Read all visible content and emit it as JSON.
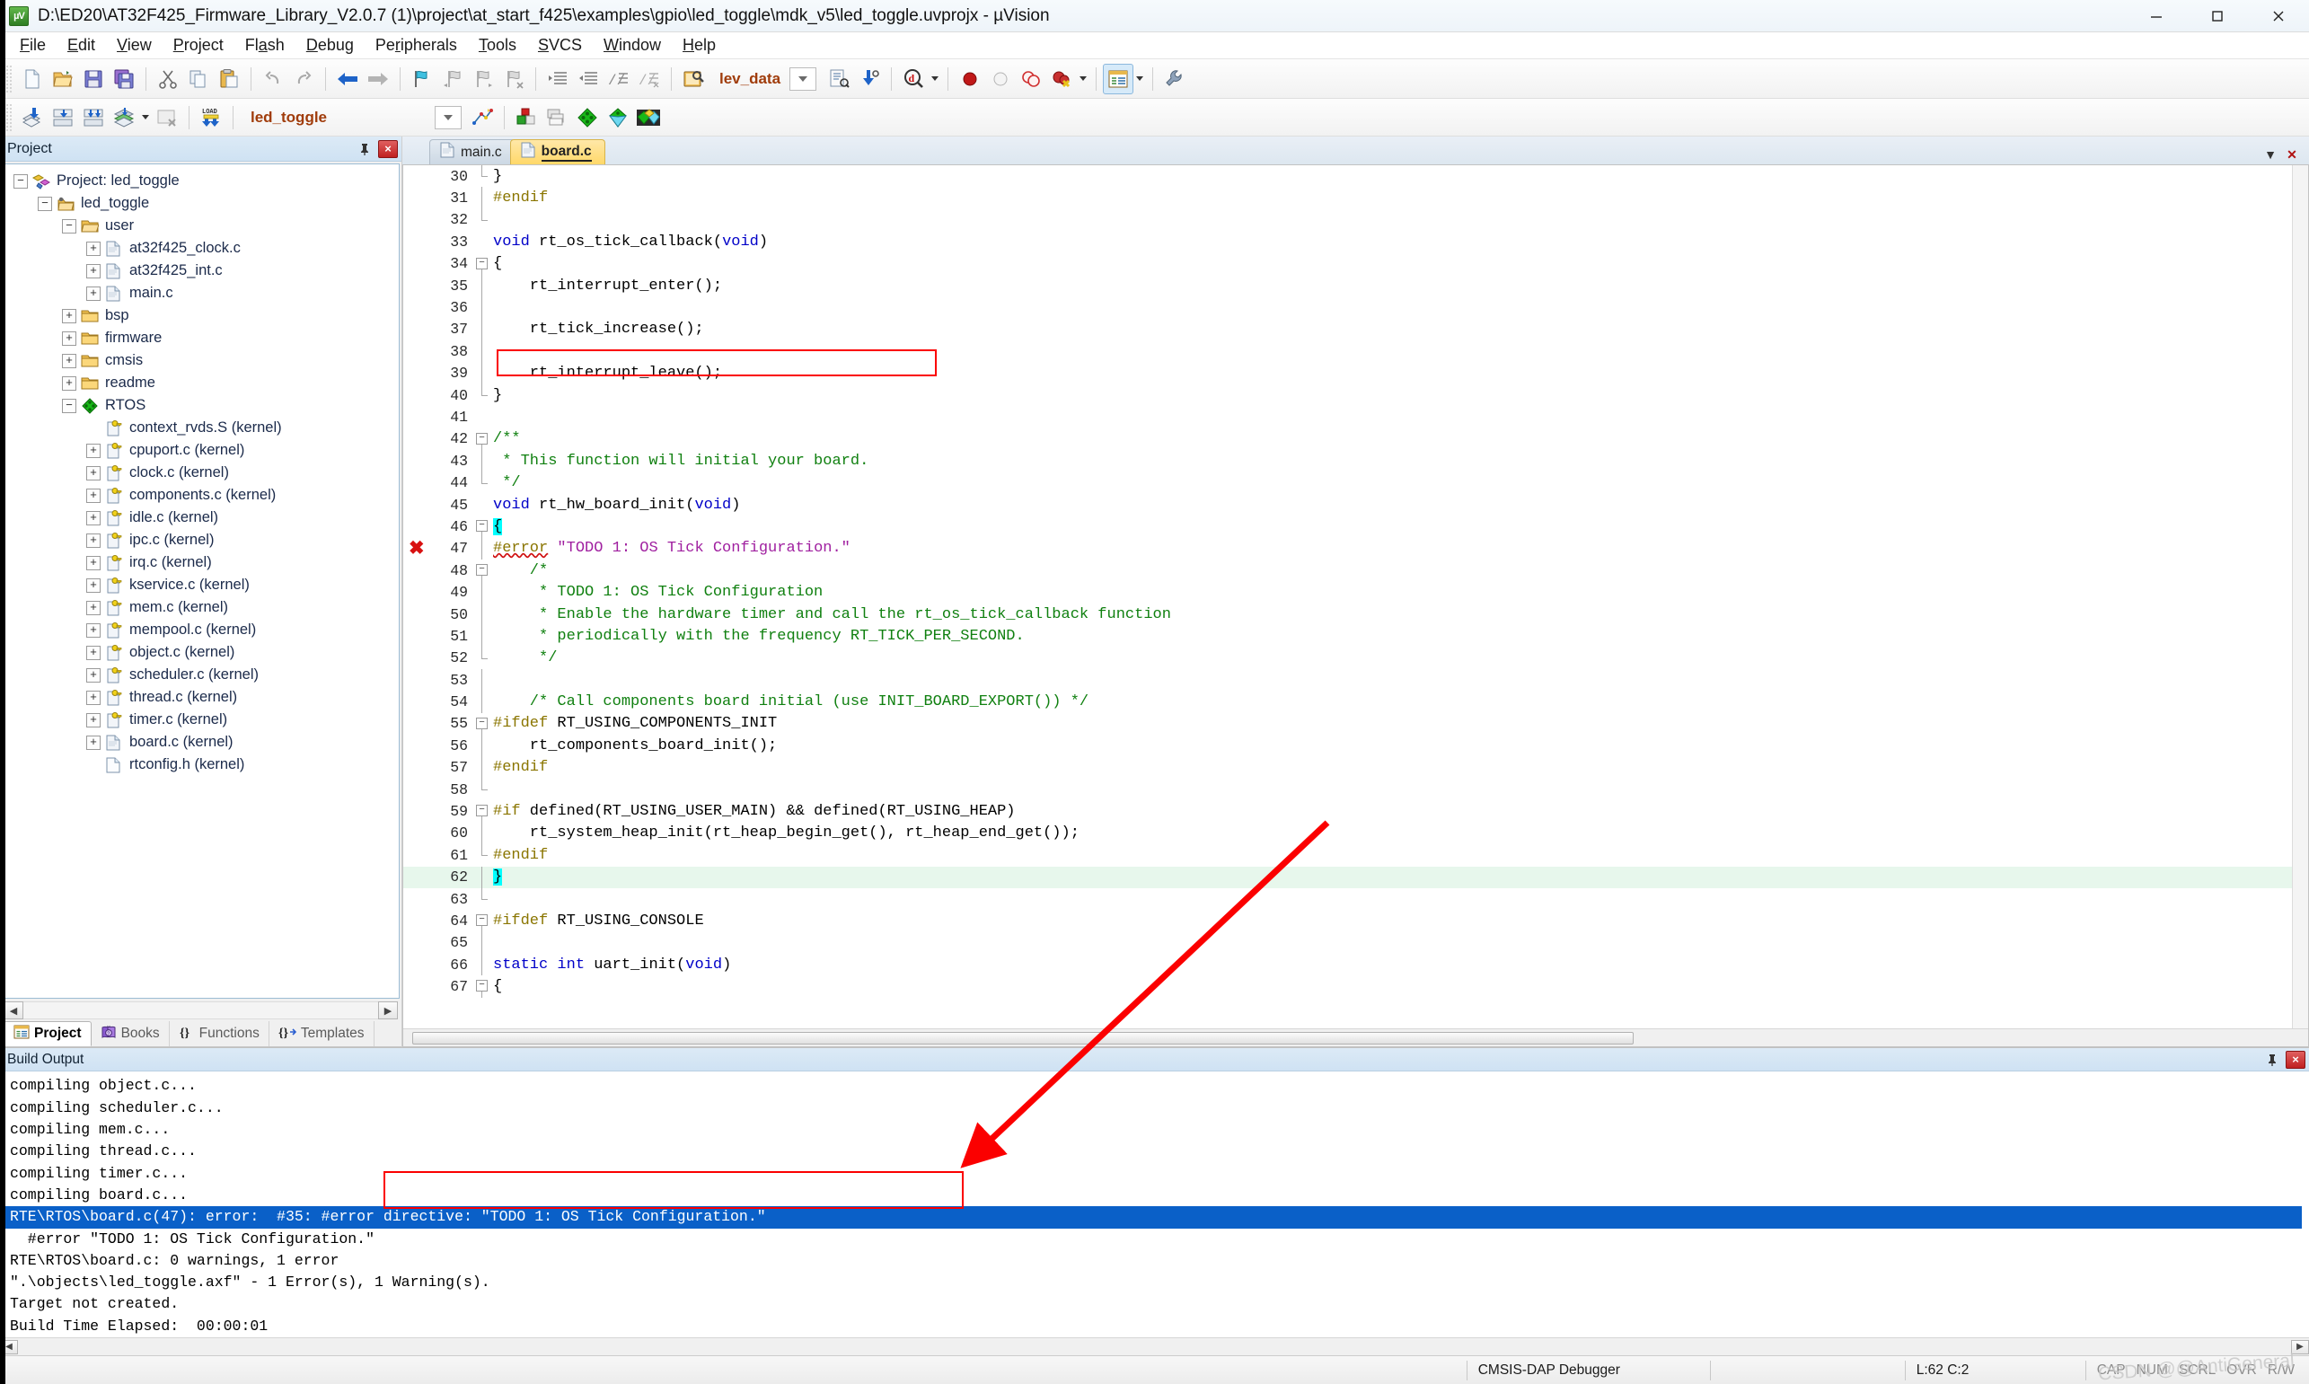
{
  "window": {
    "title": "D:\\ED20\\AT32F425_Firmware_Library_V2.0.7 (1)\\project\\at_start_f425\\examples\\gpio\\led_toggle\\mdk_v5\\led_toggle.uvprojx - µVision",
    "app_icon_text": "µV",
    "minimize": "─",
    "maximize": "❐",
    "close": "✕"
  },
  "menu": [
    {
      "label": "File",
      "accel": "F"
    },
    {
      "label": "Edit",
      "accel": "E"
    },
    {
      "label": "View",
      "accel": "V"
    },
    {
      "label": "Project",
      "accel": "P"
    },
    {
      "label": "Flash",
      "accel": "a"
    },
    {
      "label": "Debug",
      "accel": "D"
    },
    {
      "label": "Peripherals",
      "accel": "r"
    },
    {
      "label": "Tools",
      "accel": "T"
    },
    {
      "label": "SVCS",
      "accel": "S"
    },
    {
      "label": "Window",
      "accel": "W"
    },
    {
      "label": "Help",
      "accel": "H"
    }
  ],
  "toolbar_main": {
    "search_value": "lev_data",
    "icons": [
      "new-file-icon",
      "open-file-icon",
      "save-icon",
      "save-all-icon",
      "cut-icon",
      "copy-icon",
      "paste-icon",
      "undo-icon",
      "redo-icon",
      "navigate-back-icon",
      "navigate-forward-icon",
      "bookmark-toggle-icon",
      "bookmark-prev-icon",
      "bookmark-next-icon",
      "bookmark-clear-icon",
      "indent-icon",
      "outdent-icon",
      "comment-icon",
      "uncomment-icon",
      "find-in-files-icon"
    ],
    "right_icons": [
      "insert-template-icon",
      "configure-debug-icon",
      "find-icon",
      "insert-breakpoint-icon",
      "disable-breakpoint-icon",
      "disable-all-breakpoints-icon",
      "kill-all-breakpoints-icon",
      "project-window-icon",
      "configure-icon"
    ]
  },
  "toolbar_build": {
    "target_value": "led_toggle",
    "icons": [
      "translate-icon",
      "build-icon",
      "rebuild-icon",
      "batch-build-icon",
      "stop-build-icon",
      "download-icon",
      "target-options-icon",
      "manage-project-items-icon",
      "pack-installer-icon",
      "manage-rte-icon",
      "select-software-packs-icon"
    ]
  },
  "project_panel": {
    "title": "Project",
    "pin_icon": "pin-icon",
    "close_icon": "close-icon",
    "tree": [
      {
        "label": "Project: led_toggle",
        "depth": 0,
        "expander": "minus",
        "icon": "project-icon"
      },
      {
        "label": "led_toggle",
        "depth": 1,
        "expander": "minus",
        "icon": "target-icon"
      },
      {
        "label": "user",
        "depth": 2,
        "expander": "minus",
        "icon": "folder-open-icon"
      },
      {
        "label": "at32f425_clock.c",
        "depth": 3,
        "expander": "plus",
        "icon": "c-file-icon"
      },
      {
        "label": "at32f425_int.c",
        "depth": 3,
        "expander": "plus",
        "icon": "c-file-icon"
      },
      {
        "label": "main.c",
        "depth": 3,
        "expander": "plus",
        "icon": "c-file-icon"
      },
      {
        "label": "bsp",
        "depth": 2,
        "expander": "plus",
        "icon": "folder-icon"
      },
      {
        "label": "firmware",
        "depth": 2,
        "expander": "plus",
        "icon": "folder-icon"
      },
      {
        "label": "cmsis",
        "depth": 2,
        "expander": "plus",
        "icon": "folder-icon"
      },
      {
        "label": "readme",
        "depth": 2,
        "expander": "plus",
        "icon": "folder-icon"
      },
      {
        "label": "RTOS",
        "depth": 2,
        "expander": "minus",
        "icon": "rte-component-icon"
      },
      {
        "label": "context_rvds.S (kernel)",
        "depth": 3,
        "expander": "none",
        "icon": "rte-file-icon"
      },
      {
        "label": "cpuport.c (kernel)",
        "depth": 3,
        "expander": "plus",
        "icon": "rte-file-icon"
      },
      {
        "label": "clock.c (kernel)",
        "depth": 3,
        "expander": "plus",
        "icon": "rte-file-icon"
      },
      {
        "label": "components.c (kernel)",
        "depth": 3,
        "expander": "plus",
        "icon": "rte-file-icon"
      },
      {
        "label": "idle.c (kernel)",
        "depth": 3,
        "expander": "plus",
        "icon": "rte-file-icon"
      },
      {
        "label": "ipc.c (kernel)",
        "depth": 3,
        "expander": "plus",
        "icon": "rte-file-icon"
      },
      {
        "label": "irq.c (kernel)",
        "depth": 3,
        "expander": "plus",
        "icon": "rte-file-icon"
      },
      {
        "label": "kservice.c (kernel)",
        "depth": 3,
        "expander": "plus",
        "icon": "rte-file-icon"
      },
      {
        "label": "mem.c (kernel)",
        "depth": 3,
        "expander": "plus",
        "icon": "rte-file-icon"
      },
      {
        "label": "mempool.c (kernel)",
        "depth": 3,
        "expander": "plus",
        "icon": "rte-file-icon"
      },
      {
        "label": "object.c (kernel)",
        "depth": 3,
        "expander": "plus",
        "icon": "rte-file-icon"
      },
      {
        "label": "scheduler.c (kernel)",
        "depth": 3,
        "expander": "plus",
        "icon": "rte-file-icon"
      },
      {
        "label": "thread.c (kernel)",
        "depth": 3,
        "expander": "plus",
        "icon": "rte-file-icon"
      },
      {
        "label": "timer.c (kernel)",
        "depth": 3,
        "expander": "plus",
        "icon": "rte-file-icon"
      },
      {
        "label": "board.c (kernel)",
        "depth": 3,
        "expander": "plus",
        "icon": "c-file-icon"
      },
      {
        "label": "rtconfig.h (kernel)",
        "depth": 3,
        "expander": "none",
        "icon": "h-file-icon"
      }
    ],
    "bottom_tabs": [
      {
        "label": "Project",
        "icon": "project-window-icon",
        "selected": true
      },
      {
        "label": "Books",
        "icon": "books-icon",
        "selected": false
      },
      {
        "label": "Functions",
        "icon": "functions-icon",
        "selected": false
      },
      {
        "label": "Templates",
        "icon": "templates-icon",
        "selected": false
      }
    ]
  },
  "editor": {
    "tabs": [
      {
        "label": "main.c",
        "active": false,
        "icon": "c-file-icon"
      },
      {
        "label": "board.c",
        "active": true,
        "icon": "c-file-icon"
      }
    ],
    "lines": [
      {
        "n": "30",
        "fold": "end",
        "text": "}",
        "cls": "plain"
      },
      {
        "n": "31",
        "fold": "bar",
        "text": "#endif",
        "cls": "pp"
      },
      {
        "n": "32",
        "fold": "endbar",
        "text": "",
        "cls": "plain"
      },
      {
        "n": "33",
        "fold": "none",
        "text": "void rt_os_tick_callback(void)",
        "cls": "fn1"
      },
      {
        "n": "34",
        "fold": "start",
        "text": "{",
        "cls": "plain"
      },
      {
        "n": "35",
        "fold": "bar",
        "text": "    rt_interrupt_enter();",
        "cls": "plain"
      },
      {
        "n": "36",
        "fold": "bar",
        "text": "",
        "cls": "plain"
      },
      {
        "n": "37",
        "fold": "bar",
        "text": "    rt_tick_increase();",
        "cls": "plain"
      },
      {
        "n": "38",
        "fold": "bar",
        "text": "",
        "cls": "plain"
      },
      {
        "n": "39",
        "fold": "bar",
        "text": "    rt_interrupt_leave();",
        "cls": "plain"
      },
      {
        "n": "40",
        "fold": "end",
        "text": "}",
        "cls": "plain"
      },
      {
        "n": "41",
        "fold": "none",
        "text": "",
        "cls": "plain"
      },
      {
        "n": "42",
        "fold": "start",
        "text": "/**",
        "cls": "cmt"
      },
      {
        "n": "43",
        "fold": "bar",
        "text": " * This function will initial your board.",
        "cls": "cmt"
      },
      {
        "n": "44",
        "fold": "end",
        "text": " */",
        "cls": "cmt"
      },
      {
        "n": "45",
        "fold": "none",
        "text": "void rt_hw_board_init(void)",
        "cls": "fn2"
      },
      {
        "n": "46",
        "fold": "start",
        "text": "{",
        "cls": "cursor-brace"
      },
      {
        "n": "47",
        "fold": "bar",
        "text": "#error \"TODO 1: OS Tick Configuration.\"",
        "cls": "error-line"
      },
      {
        "n": "48",
        "fold": "start",
        "text": "    /*",
        "cls": "cmt"
      },
      {
        "n": "49",
        "fold": "bar",
        "text": "     * TODO 1: OS Tick Configuration",
        "cls": "cmt"
      },
      {
        "n": "50",
        "fold": "bar",
        "text": "     * Enable the hardware timer and call the rt_os_tick_callback function",
        "cls": "cmt"
      },
      {
        "n": "51",
        "fold": "bar",
        "text": "     * periodically with the frequency RT_TICK_PER_SECOND.",
        "cls": "cmt"
      },
      {
        "n": "52",
        "fold": "end",
        "text": "     */",
        "cls": "cmt"
      },
      {
        "n": "53",
        "fold": "bar",
        "text": "",
        "cls": "plain"
      },
      {
        "n": "54",
        "fold": "bar",
        "text": "    /* Call components board initial (use INIT_BOARD_EXPORT()) */",
        "cls": "cmt"
      },
      {
        "n": "55",
        "fold": "start",
        "text": "#ifdef RT_USING_COMPONENTS_INIT",
        "cls": "pp"
      },
      {
        "n": "56",
        "fold": "bar",
        "text": "    rt_components_board_init();",
        "cls": "plain"
      },
      {
        "n": "57",
        "fold": "bar",
        "text": "#endif",
        "cls": "pp"
      },
      {
        "n": "58",
        "fold": "endbar",
        "text": "",
        "cls": "plain"
      },
      {
        "n": "59",
        "fold": "start",
        "text": "#if defined(RT_USING_USER_MAIN) && defined(RT_USING_HEAP)",
        "cls": "pp"
      },
      {
        "n": "60",
        "fold": "bar",
        "text": "    rt_system_heap_init(rt_heap_begin_get(), rt_heap_end_get());",
        "cls": "plain"
      },
      {
        "n": "61",
        "fold": "end",
        "text": "#endif",
        "cls": "pp"
      },
      {
        "n": "62",
        "fold": "bar",
        "text": "}",
        "cls": "highlight-brace"
      },
      {
        "n": "63",
        "fold": "endbar",
        "text": "",
        "cls": "plain"
      },
      {
        "n": "64",
        "fold": "start",
        "text": "#ifdef RT_USING_CONSOLE",
        "cls": "pp"
      },
      {
        "n": "65",
        "fold": "bar",
        "text": "",
        "cls": "plain"
      },
      {
        "n": "66",
        "fold": "bar",
        "text": "static int uart_init(void)",
        "cls": "fn3"
      },
      {
        "n": "67",
        "fold": "start",
        "text": "{",
        "cls": "plain"
      }
    ],
    "error_marker": "error-marker-icon"
  },
  "build_output": {
    "title": "Build Output",
    "pin_icon": "pin-icon",
    "close_icon": "close-icon",
    "lines": [
      {
        "text": "compiling object.c...",
        "selected": false
      },
      {
        "text": "compiling scheduler.c...",
        "selected": false
      },
      {
        "text": "compiling mem.c...",
        "selected": false
      },
      {
        "text": "compiling thread.c...",
        "selected": false
      },
      {
        "text": "compiling timer.c...",
        "selected": false
      },
      {
        "text": "compiling board.c...",
        "selected": false
      },
      {
        "text": "RTE\\RTOS\\board.c(47): error:  #35: #error directive: \"TODO 1: OS Tick Configuration.\"",
        "selected": true
      },
      {
        "text": "  #error \"TODO 1: OS Tick Configuration.\"",
        "selected": false
      },
      {
        "text": "RTE\\RTOS\\board.c: 0 warnings, 1 error",
        "selected": false
      },
      {
        "text": "\".\\objects\\led_toggle.axf\" - 1 Error(s), 1 Warning(s).",
        "selected": false
      },
      {
        "text": "Target not created.",
        "selected": false
      },
      {
        "text": "Build Time Elapsed:  00:00:01",
        "selected": false
      }
    ]
  },
  "statusbar": {
    "debugger": "CMSIS-DAP Debugger",
    "middle": "",
    "cursor": "L:62 C:2",
    "flags": [
      "CAP",
      "NUM",
      "SCRL",
      "OVR",
      "R/W"
    ]
  },
  "watermark": "CSDN @@AntiGeneral",
  "colors": {
    "accent": "#0a60c8",
    "error": "#fb0000",
    "keyword": "#0000c8",
    "comment": "#108010",
    "string": "#a020a0",
    "preprocessor": "#8a7500",
    "active_tab": "#ffd869"
  }
}
